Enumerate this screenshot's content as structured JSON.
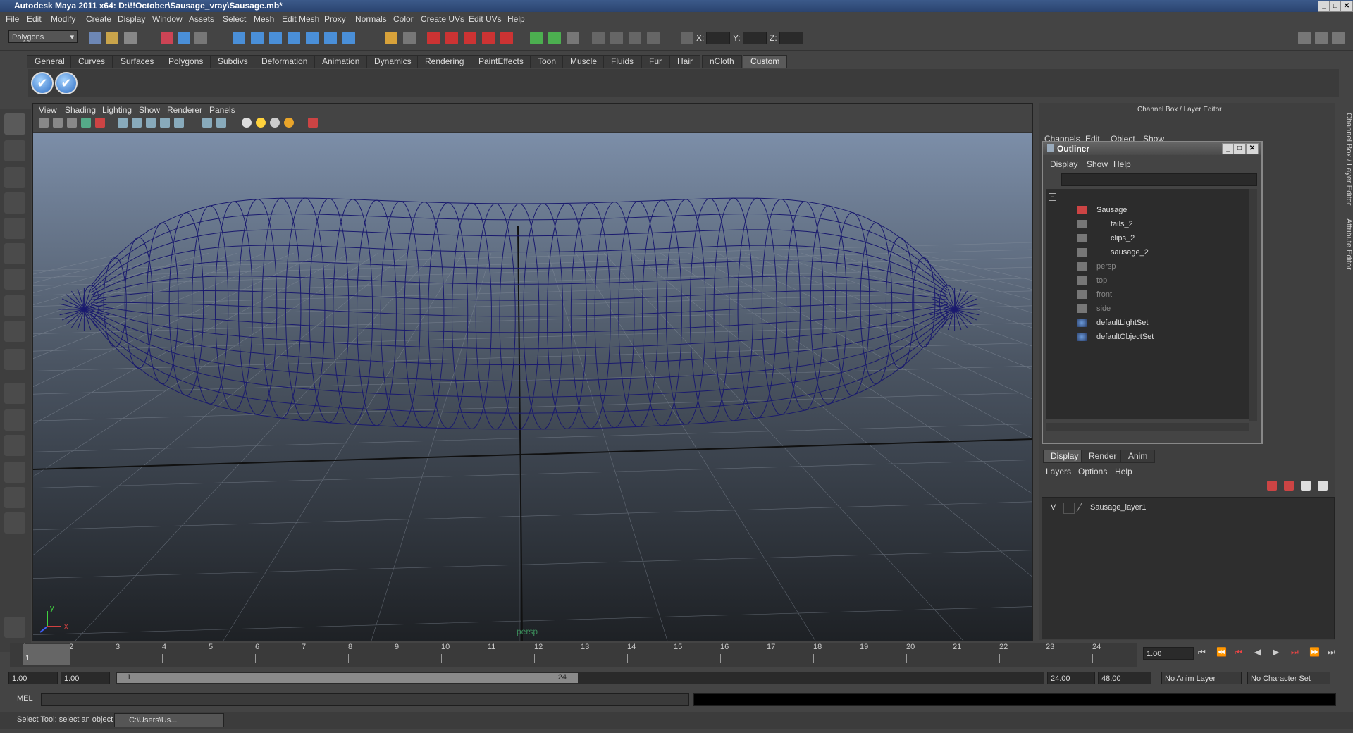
{
  "window": {
    "title": "Autodesk Maya 2011 x64: D:\\!!October\\Sausage_vray\\Sausage.mb*",
    "buttons": [
      "_",
      "□",
      "✕"
    ]
  },
  "menubar": [
    "File",
    "Edit",
    "Modify",
    "Create",
    "Display",
    "Window",
    "Assets",
    "Select",
    "Mesh",
    "Edit Mesh",
    "Proxy",
    "Normals",
    "Color",
    "Create UVs",
    "Edit UVs",
    "Help"
  ],
  "status": {
    "mode_select": "Polygons",
    "x_label": "X:",
    "y_label": "Y:",
    "z_label": "Z:"
  },
  "shelf": {
    "tabs": [
      "General",
      "Curves",
      "Surfaces",
      "Polygons",
      "Subdivs",
      "Deformation",
      "Animation",
      "Dynamics",
      "Rendering",
      "PaintEffects",
      "Toon",
      "Muscle",
      "Fluids",
      "Fur",
      "Hair",
      "nCloth",
      "Custom"
    ],
    "active_tab": "Custom",
    "buttons": [
      "✔",
      "✔"
    ]
  },
  "viewport": {
    "menu": [
      "View",
      "Shading",
      "Lighting",
      "Show",
      "Renderer",
      "Panels"
    ],
    "camera_label": "persp",
    "axis_y": "y",
    "axis_x": "x",
    "wire_color": "#1a1a6e"
  },
  "channel_box": {
    "title": "Channel Box / Layer Editor",
    "menu": [
      "Channels",
      "Edit",
      "Object",
      "Show"
    ],
    "side_tabs": [
      "Channel Box / Layer Editor",
      "Attribute Editor"
    ]
  },
  "outliner": {
    "title": "Outliner",
    "menu": [
      "Display",
      "Show",
      "Help"
    ],
    "items": [
      {
        "label": "Sausage",
        "icon": "transform-icon",
        "dim": false
      },
      {
        "label": "tails_2",
        "icon": "mesh-icon",
        "dim": false
      },
      {
        "label": "clips_2",
        "icon": "mesh-icon",
        "dim": false
      },
      {
        "label": "sausage_2",
        "icon": "mesh-icon",
        "dim": false
      },
      {
        "label": "persp",
        "icon": "camera-icon",
        "dim": true
      },
      {
        "label": "top",
        "icon": "camera-icon",
        "dim": true
      },
      {
        "label": "front",
        "icon": "camera-icon",
        "dim": true
      },
      {
        "label": "side",
        "icon": "camera-icon",
        "dim": true
      },
      {
        "label": "defaultLightSet",
        "icon": "set-icon",
        "dim": false
      },
      {
        "label": "defaultObjectSet",
        "icon": "set-icon",
        "dim": false
      }
    ]
  },
  "layer_editor": {
    "tabs": [
      "Display",
      "Render",
      "Anim"
    ],
    "menu": [
      "Layers",
      "Options",
      "Help"
    ],
    "layers": [
      {
        "visible": "V",
        "name": "Sausage_layer1"
      }
    ]
  },
  "timeline": {
    "ticks": [
      "1",
      "2",
      "3",
      "4",
      "5",
      "6",
      "7",
      "8",
      "9",
      "10",
      "11",
      "12",
      "13",
      "14",
      "15",
      "16",
      "17",
      "18",
      "19",
      "20",
      "21",
      "22",
      "23",
      "24"
    ],
    "current_frame_label": "1",
    "current_time": "1.00"
  },
  "range": {
    "start": "1.00",
    "start2": "1.00",
    "slider_min": "1",
    "slider_max": "24",
    "end": "24.00",
    "end2": "48.00",
    "anim_layer": "No Anim Layer",
    "character_set": "No Character Set"
  },
  "command": {
    "mel_label": "MEL"
  },
  "helpline": {
    "text": "Select Tool: select an object",
    "taskbar_item": "C:\\Users\\Us..."
  }
}
